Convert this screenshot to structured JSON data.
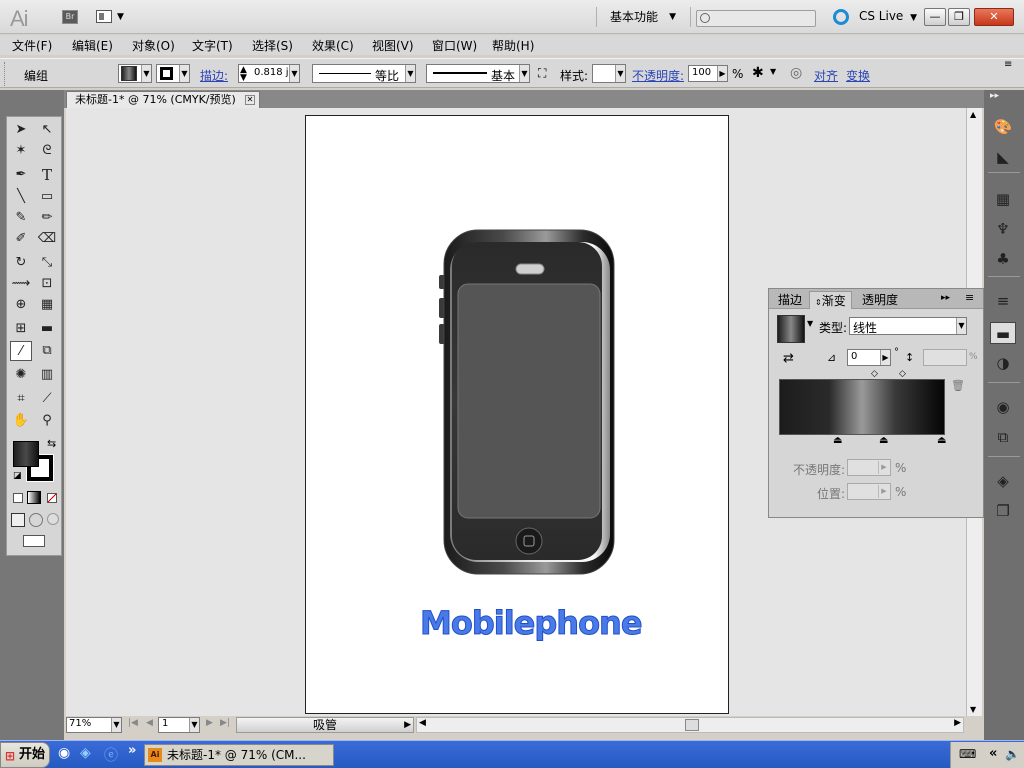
{
  "app": {
    "logo_text": "Ai",
    "bridge_label": "Br",
    "workspace_label": "基本功能",
    "search_placeholder": "",
    "cslive_label": "CS Live"
  },
  "window_buttons": {
    "minimize": "—",
    "restore": "❐",
    "close": "✕"
  },
  "menu": {
    "items": [
      "文件(F)",
      "编辑(E)",
      "对象(O)",
      "文字(T)",
      "选择(S)",
      "效果(C)",
      "视图(V)",
      "窗口(W)",
      "帮助(H)"
    ]
  },
  "control_bar": {
    "context_label": "编组",
    "stroke_link": "描边:",
    "stroke_value": "0.818 j",
    "profile_label": "等比",
    "brush_label": "基本",
    "style_label": "样式:",
    "opacity_link": "不透明度:",
    "opacity_value": "100",
    "percent": "%",
    "align_link": "对齐",
    "transform_link": "变换"
  },
  "document": {
    "tab_title": "未标题-1* @ 71% (CMYK/预览)",
    "artwork_text": "Mobilephone"
  },
  "gradient_panel": {
    "tabs": [
      "描边",
      "渐变",
      "透明度"
    ],
    "active_tab": "渐变",
    "type_label": "类型:",
    "type_value": "线性",
    "angle_value": "0",
    "degree": "°",
    "aspect_percent": "%",
    "opacity_label": "不透明度:",
    "location_label": "位置:",
    "percent": "%"
  },
  "status": {
    "zoom_value": "71%",
    "page_value": "1",
    "tool_name": "吸管"
  },
  "taskbar": {
    "start_label": "开始",
    "task_label": "未标题-1* @ 71% (CM...",
    "chevron": "»"
  },
  "colors": {
    "artwork_text": "#4a7ae8",
    "accent_link": "#2b44b8",
    "cslive": "#1c8ad6"
  }
}
